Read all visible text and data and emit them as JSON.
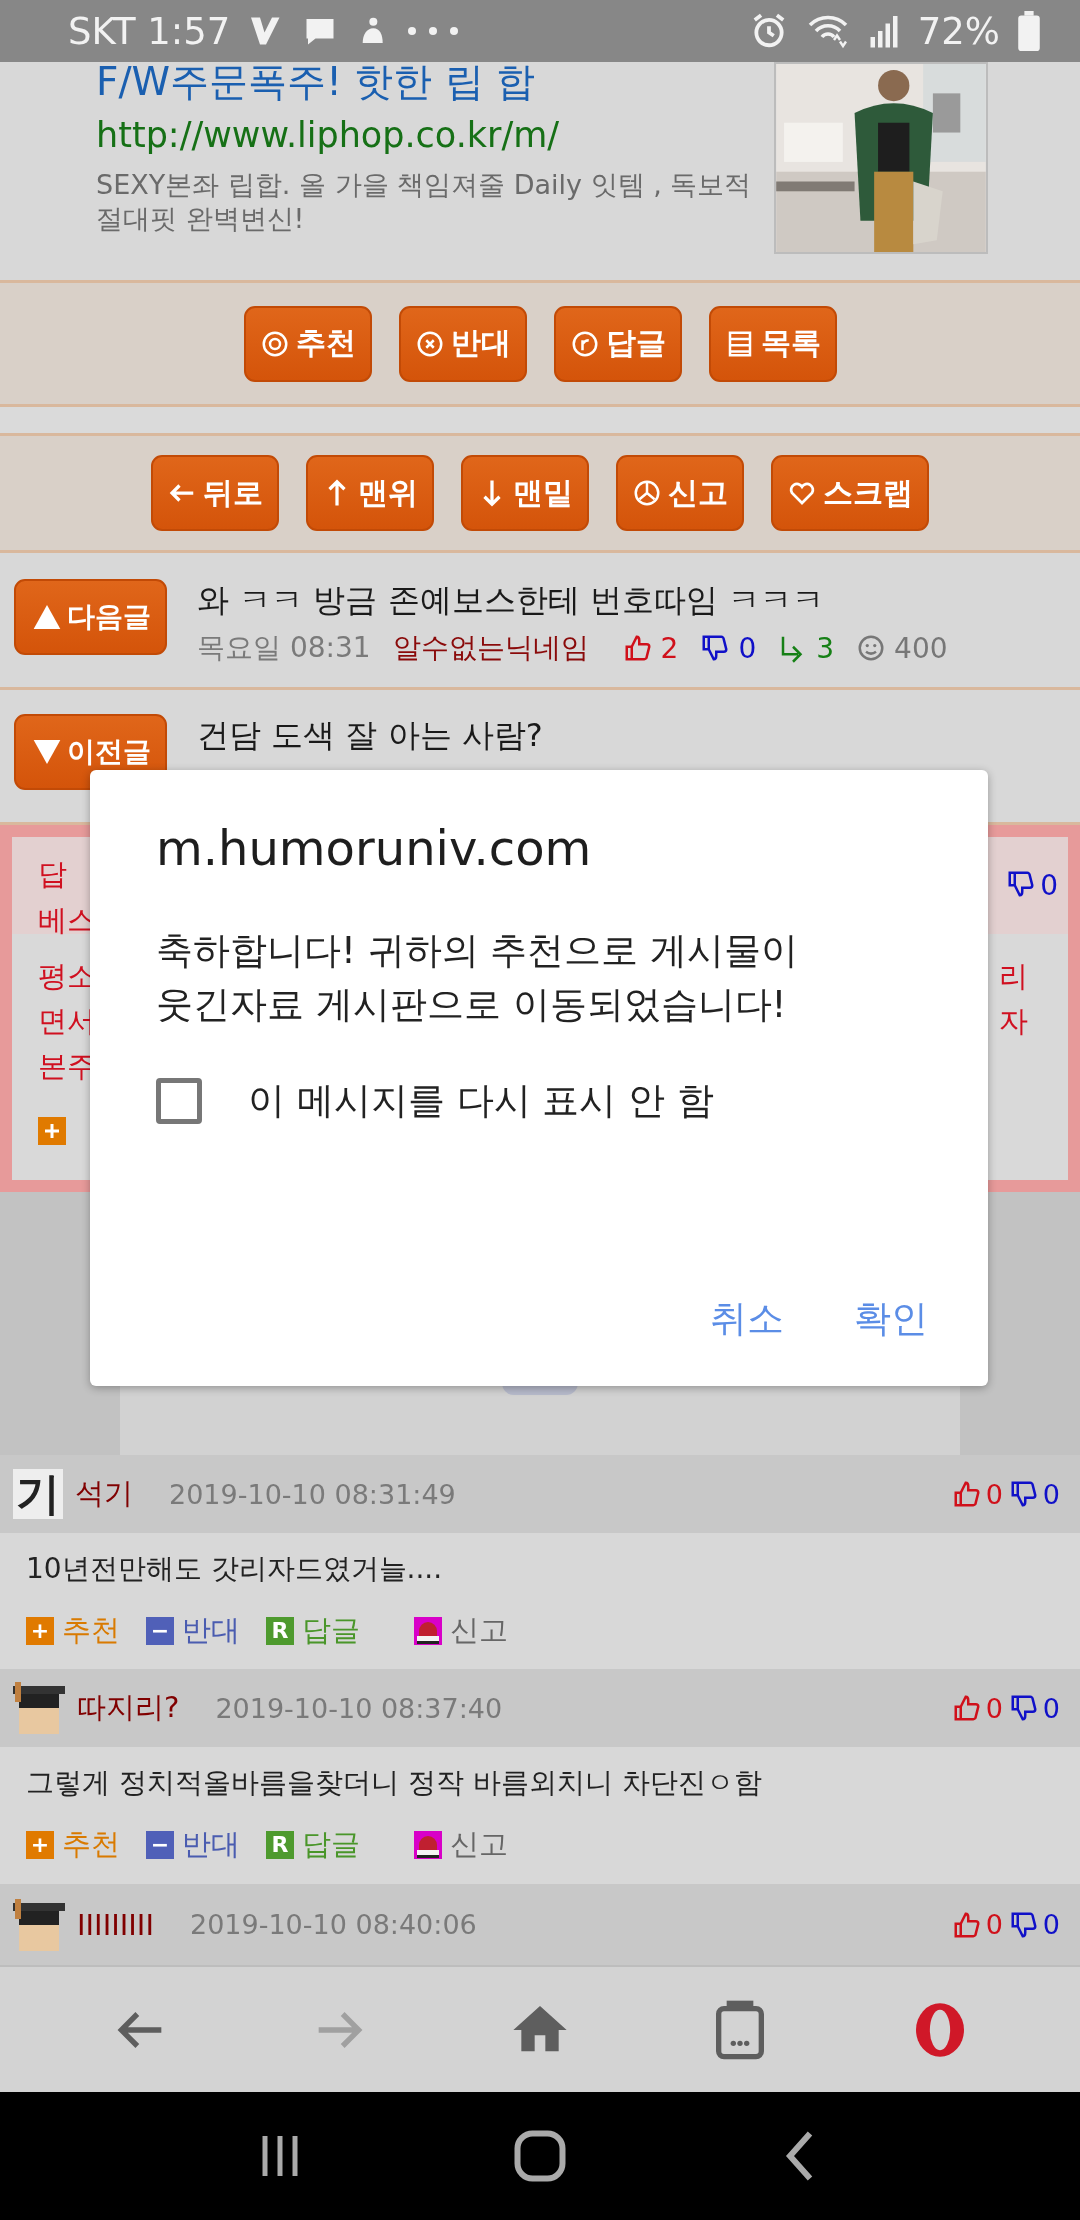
{
  "status_bar": {
    "carrier_time": "SKT 1:57",
    "battery": "72%"
  },
  "ad": {
    "title": "F/W주문폭주! 핫한 립 합",
    "url": "http://www.liphop.co.kr/m/",
    "description": "SEXY본좌 립합. 올 가을 책임져줄 Daily 잇템 , 독보적 절대핏 완벽변신!"
  },
  "post_buttons": [
    {
      "kind": "target",
      "label": "추천"
    },
    {
      "kind": "cancel",
      "label": "반대"
    },
    {
      "kind": "reply",
      "label": "답글"
    },
    {
      "kind": "list",
      "label": "목록"
    }
  ],
  "nav_buttons": [
    {
      "kind": "back",
      "label": "뒤로"
    },
    {
      "kind": "top",
      "label": "맨위"
    },
    {
      "kind": "bottom",
      "label": "맨밑"
    },
    {
      "kind": "report",
      "label": "신고"
    },
    {
      "kind": "heart",
      "label": "스크랩"
    }
  ],
  "adjacent_posts": [
    {
      "kind": "next",
      "button": "다음글",
      "title": "와 ㅋㅋ 방금 존예보스한테 번호따임 ㅋㅋㅋ",
      "time": "목요일 08:31",
      "author": "알수없는닉네임",
      "likes": "2",
      "dislikes": "0",
      "replies": "3",
      "views": "400"
    },
    {
      "kind": "previous",
      "button": "이전글",
      "title": "건담 도색 잘 아는 사람?"
    }
  ],
  "best_reply": {
    "header_left": [
      "답",
      "베스"
    ],
    "header_dislikes": "0",
    "body_left": [
      "평소",
      "면서",
      "본주"
    ],
    "body_right": [
      "리",
      "자"
    ]
  },
  "dialog": {
    "title": "m.humoruniv.com",
    "message": "축하합니다! 귀하의 추천으로 게시물이 웃긴자료 게시판으로 이동되었습니다!",
    "checkbox": {
      "label": "이 메시지를 다시 표시 안 함",
      "checked": false
    },
    "buttons": [
      "취소",
      "확인"
    ]
  },
  "comments": [
    {
      "avatar": {
        "kind": "text",
        "text": "기"
      },
      "author": "석기",
      "date": "2019-10-10 08:31:49",
      "likes": "0",
      "dislikes": "0",
      "body": "10년전만해도 갓리자드였거늘....",
      "actions": [
        {
          "kind": "recommend",
          "badge": "+",
          "label": "추천"
        },
        {
          "kind": "oppose",
          "badge": "−",
          "label": "반대"
        },
        {
          "kind": "reply",
          "badge": "R",
          "label": "답글"
        },
        {
          "kind": "report",
          "label": "신고"
        }
      ]
    },
    {
      "avatar": {
        "kind": "graduate"
      },
      "author": "따지리?",
      "date": "2019-10-10 08:37:40",
      "likes": "0",
      "dislikes": "0",
      "body": "그렇게 정치적올바름을찾더니 정작 바름외치니 차단진ㅇ함",
      "actions": [
        {
          "kind": "recommend",
          "badge": "+",
          "label": "추천"
        },
        {
          "kind": "oppose",
          "badge": "−",
          "label": "반대"
        },
        {
          "kind": "reply",
          "badge": "R",
          "label": "답글"
        },
        {
          "kind": "report",
          "label": "신고"
        }
      ]
    },
    {
      "avatar": {
        "kind": "graduate"
      },
      "author": "IIIIIIIII",
      "date": "2019-10-10 08:40:06",
      "likes": "0",
      "dislikes": "0"
    }
  ],
  "browser_toolbar": {
    "forward_disabled": true
  }
}
